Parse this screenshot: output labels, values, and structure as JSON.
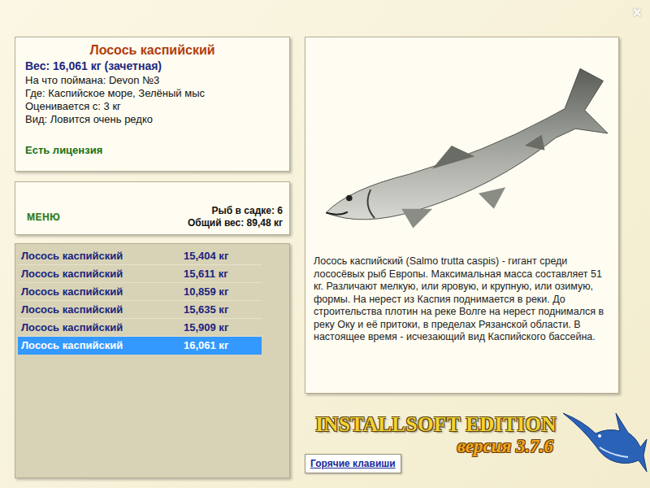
{
  "window": {
    "close": "×"
  },
  "info": {
    "title": "Лосось каспийский",
    "weight": "Вес: 16,061 кг (зачетная)",
    "lines": [
      "На что поймана: Devon №3",
      "Где: Каспийское море, Зелёный мыс",
      "Оценивается с: 3 кг",
      "Вид: Ловится очень редко"
    ],
    "license": "Есть лицензия"
  },
  "keepnet": {
    "menu": "МЕНЮ",
    "count": "Рыб в садке: 6",
    "total": "Общий вес: 89,48 кг"
  },
  "catch_list": [
    {
      "name": "Лосось каспийский",
      "weight": "15,404 кг",
      "selected": false
    },
    {
      "name": "Лосось каспийский",
      "weight": "15,611 кг",
      "selected": false
    },
    {
      "name": "Лосось каспийский",
      "weight": "10,859 кг",
      "selected": false
    },
    {
      "name": "Лосось каспийский",
      "weight": "15,635 кг",
      "selected": false
    },
    {
      "name": "Лосось каспийский",
      "weight": "15,909 кг",
      "selected": false
    },
    {
      "name": "Лосось каспийский",
      "weight": "16,061 кг",
      "selected": true
    }
  ],
  "description": "Лосось каспийский (Salmo trutta caspis) - гигант среди лососёвых рыб Европы. Максимальная масса составляет 51 кг. Различают мелкую, или яровую, и крупную, или озимую, формы. На нерест из Каспия поднимается в реки. До строительства плотин на реке Волге на нерест поднимался в реку Оку и её притоки, в пределах Рязанской области. В настоящее время - исчезающий вид Каспийского бассейна.",
  "logo": {
    "title": "INSTALLSOFT EDITION",
    "version": "версия 3.7.6"
  },
  "buttons": [
    "Горячие клавиши"
  ]
}
